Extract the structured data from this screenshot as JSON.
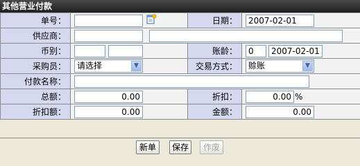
{
  "window": {
    "title": "其他营业付款"
  },
  "form": {
    "order_no": {
      "label": "单号：",
      "value": ""
    },
    "date": {
      "label": "日期：",
      "value": "2007-02-01"
    },
    "supplier": {
      "label": "供应商：",
      "code": "",
      "name": ""
    },
    "currency": {
      "label": "币别：",
      "code": "",
      "rate": ""
    },
    "aging": {
      "label": "账龄：",
      "days": "0",
      "date": "2007-02-01"
    },
    "buyer": {
      "label": "采购员：",
      "selected": "请选择"
    },
    "trade_mode": {
      "label": "交易方式：",
      "selected": "赊账"
    },
    "payment_name": {
      "label": "付款名称：",
      "value": ""
    },
    "total": {
      "label": "总额：",
      "value": "0.00"
    },
    "discount": {
      "label": "折扣：",
      "value": "0.00",
      "unit": "%"
    },
    "discount_amount": {
      "label": "折扣额：",
      "value": "0.00"
    },
    "amount": {
      "label": "金额：",
      "value": "0.00"
    }
  },
  "buttons": {
    "new": "新单",
    "save": "保存",
    "void": "作废"
  },
  "icons": {
    "order_lookup": "new-document-icon",
    "dropdown": "chevron-down-icon"
  }
}
